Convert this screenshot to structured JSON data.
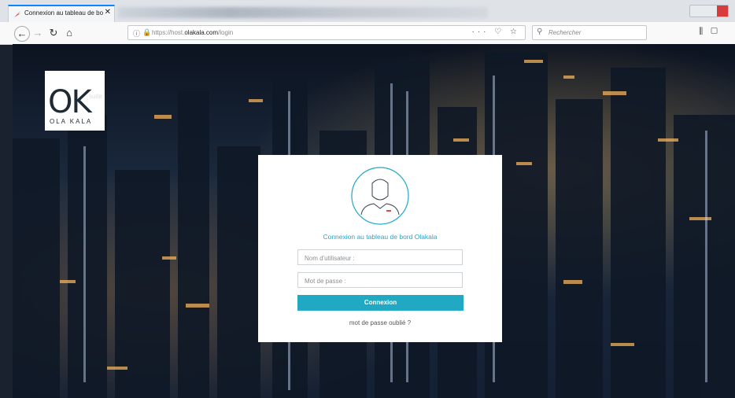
{
  "browser": {
    "tab": {
      "title": "Connexion au tableau de bord",
      "close": "✕"
    },
    "address": {
      "prefix": "https://host.",
      "domain": "olakala.com",
      "path": "/login"
    },
    "search": {
      "placeholder": "Rechercher"
    },
    "tools": "··· ♡ ☆"
  },
  "logo": {
    "suite": "suite",
    "mark": "OK",
    "name": "OLA KALA"
  },
  "login": {
    "title": "Connexion au tableau de bord Olakala",
    "username_placeholder": "Nom d'utilisateur :",
    "password_placeholder": "Mot de passe :",
    "submit_label": "Connexion",
    "forgot_label": "mot de passe oublié ?"
  },
  "colors": {
    "accent": "#21a9c3",
    "title": "#2aa3c0"
  }
}
